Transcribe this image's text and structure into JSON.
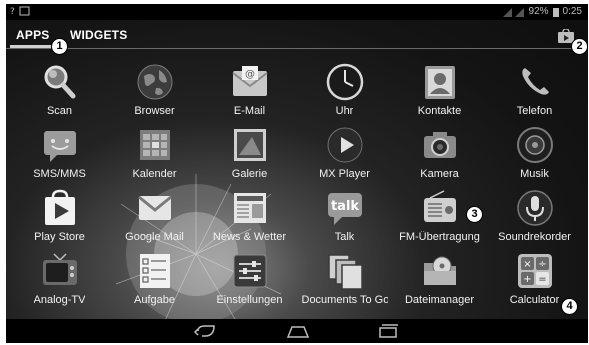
{
  "status_bar": {
    "left_icons": [
      "notification-icon",
      "image-icon"
    ],
    "battery": "92%",
    "time": "0:25"
  },
  "tabs": [
    {
      "label": "APPS",
      "selected": true
    },
    {
      "label": "WIDGETS",
      "selected": false
    }
  ],
  "apps": [
    {
      "label": "Scan",
      "icon": "magnifier-icon"
    },
    {
      "label": "Browser",
      "icon": "globe-icon"
    },
    {
      "label": "E-Mail",
      "icon": "email-icon"
    },
    {
      "label": "Uhr",
      "icon": "clock-icon"
    },
    {
      "label": "Kontakte",
      "icon": "contacts-icon"
    },
    {
      "label": "Telefon",
      "icon": "phone-icon"
    },
    {
      "label": "SMS/MMS",
      "icon": "message-icon"
    },
    {
      "label": "Kalender",
      "icon": "calendar-icon"
    },
    {
      "label": "Galerie",
      "icon": "gallery-icon"
    },
    {
      "label": "MX Player",
      "icon": "play-icon"
    },
    {
      "label": "Kamera",
      "icon": "camera-icon"
    },
    {
      "label": "Musik",
      "icon": "speaker-icon"
    },
    {
      "label": "Play Store",
      "icon": "play-store-icon"
    },
    {
      "label": "Google Mail",
      "icon": "gmail-icon"
    },
    {
      "label": "News & Wetter",
      "icon": "newspaper-icon"
    },
    {
      "label": "Talk",
      "icon": "talk-icon"
    },
    {
      "label": "FM-Übertragung",
      "icon": "radio-icon"
    },
    {
      "label": "Soundrekorder",
      "icon": "microphone-icon"
    },
    {
      "label": "Analog-TV",
      "icon": "tv-icon"
    },
    {
      "label": "Aufgabe",
      "icon": "checklist-icon"
    },
    {
      "label": "Einstellungen",
      "icon": "settings-icon"
    },
    {
      "label": "Documents To Go",
      "icon": "documents-icon"
    },
    {
      "label": "Dateimanager",
      "icon": "file-manager-icon"
    },
    {
      "label": "Calculator",
      "icon": "calculator-icon"
    }
  ],
  "nav_bar": [
    "back-icon",
    "home-icon",
    "recent-apps-icon"
  ],
  "callouts": [
    "1",
    "2",
    "3",
    "4"
  ]
}
